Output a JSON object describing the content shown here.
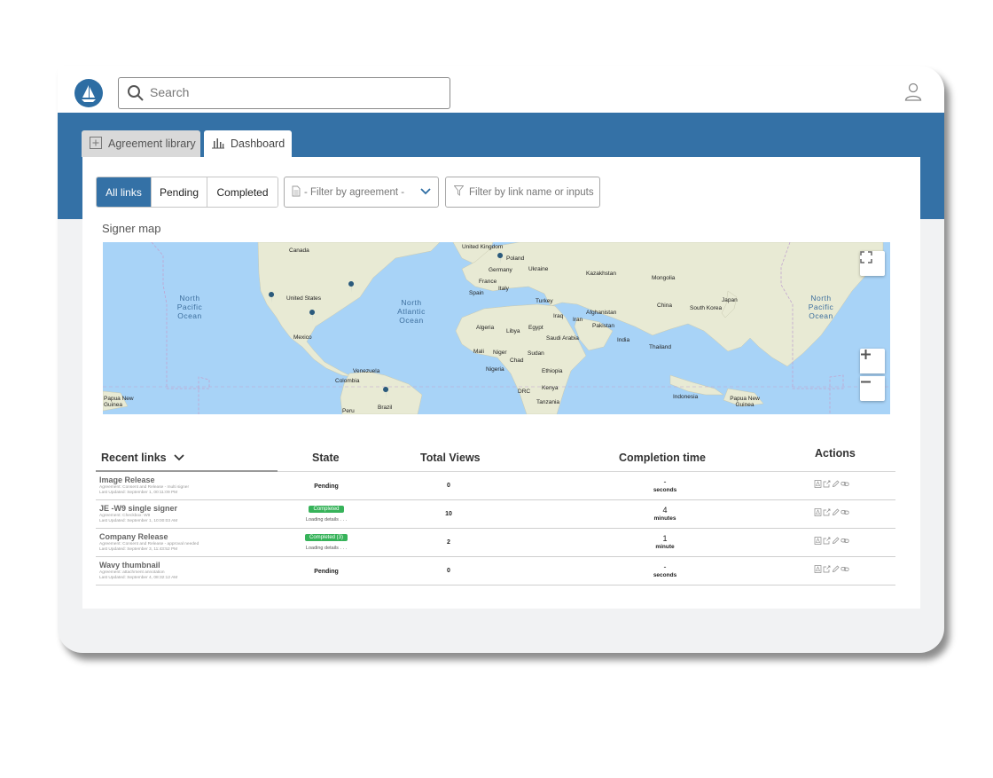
{
  "search": {
    "placeholder": "Search"
  },
  "tabs": [
    {
      "label": "Agreement library"
    },
    {
      "label": "Dashboard",
      "active": true
    }
  ],
  "filters": {
    "segments": [
      {
        "label": "All links",
        "active": true
      },
      {
        "label": "Pending"
      },
      {
        "label": "Completed"
      }
    ],
    "agreement_dropdown": "- Filter by agreement -",
    "link_filter_placeholder": "Filter by link name or inputs"
  },
  "map": {
    "title": "Signer map",
    "countries": [
      "Canada",
      "United States",
      "Mexico",
      "Venezuela",
      "Colombia",
      "Peru",
      "Brazil",
      "United Kingdom",
      "Poland",
      "Germany",
      "Ukraine",
      "France",
      "Spain",
      "Italy",
      "Turkey",
      "Kazakhstan",
      "Mongolia",
      "China",
      "South Korea",
      "Japan",
      "Afghanistan",
      "Pakistan",
      "Iraq",
      "Iran",
      "India",
      "Thailand",
      "Saudi Arabia",
      "Algeria",
      "Libya",
      "Egypt",
      "Mali",
      "Niger",
      "Chad",
      "Sudan",
      "Ethiopia",
      "Nigeria",
      "DRC",
      "Kenya",
      "Tanzania",
      "Indonesia",
      "Papua New Guinea"
    ],
    "oceans": [
      "North Pacific Ocean",
      "North Atlantic Ocean",
      "North Pacific Ocean"
    ],
    "edge_labels": [
      "Papua New Guinea"
    ]
  },
  "table": {
    "headers": {
      "name": "Recent links",
      "state": "State",
      "views": "Total Views",
      "completion": "Completion time",
      "actions": "Actions"
    },
    "rows": [
      {
        "name": "Image Release",
        "agreement": "Agreement: Consent and Release - multi signer",
        "updated": "Last Updated: September 1, 00:11:09 PM",
        "state": "Pending",
        "state_type": "pending",
        "loading": "",
        "views": "0",
        "completion_value": "-",
        "completion_unit": "seconds"
      },
      {
        "name": "JE -W9 single signer",
        "agreement": "Agreement: Checkbox: W9",
        "updated": "Last Updated: September 1, 10:00:03 AM",
        "state": "Completed",
        "state_type": "completed",
        "loading": "Loading details . . .",
        "views": "10",
        "completion_value": "4",
        "completion_unit": "minutes"
      },
      {
        "name": "Company Release",
        "agreement": "Agreement: Consent and Release - approval needed",
        "updated": "Last Updated: September 3, 11:43:52 PM",
        "state": "Completed (3)",
        "state_type": "completed",
        "loading": "Loading details . . .",
        "views": "2",
        "completion_value": "1",
        "completion_unit": "minute"
      },
      {
        "name": "Wavy thumbnail",
        "agreement": "Agreement: attachment annotation",
        "updated": "Last Updated: September 4, 08:32:12 AM",
        "state": "Pending",
        "state_type": "pending",
        "loading": "",
        "views": "0",
        "completion_value": "-",
        "completion_unit": "seconds"
      }
    ]
  },
  "colors": {
    "brand": "#3471a6",
    "success": "#37b35a",
    "water": "#a8d3f7",
    "land": "#e8ead4"
  }
}
